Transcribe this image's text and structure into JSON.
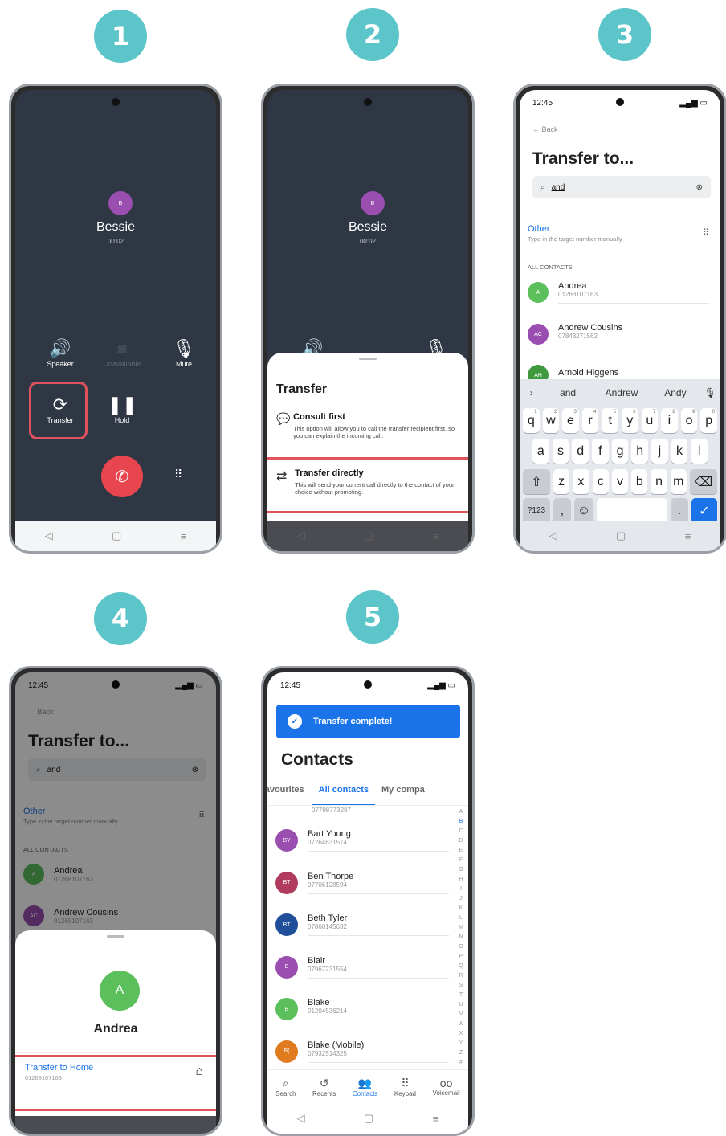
{
  "steps": [
    "1",
    "2",
    "3",
    "4",
    "5"
  ],
  "call": {
    "contact_name": "Bessie",
    "contact_initial": "B",
    "duration": "00:02",
    "speaker_label": "Speaker",
    "unavailable_label": "Unavailable",
    "mute_label": "Mute",
    "transfer_label": "Transfer",
    "hold_label": "Hold"
  },
  "transfer_sheet": {
    "title": "Transfer",
    "consult_title": "Consult first",
    "consult_desc": "This option will allow you to call the transfer recipient first, so you can explain the incoming call.",
    "direct_title": "Transfer directly",
    "direct_desc": "This will send your current call directly to the contact of your choice without prompting."
  },
  "transfer_to": {
    "time": "12:45",
    "back_label": "Back",
    "title": "Transfer to...",
    "search_value": "and",
    "other_label": "Other",
    "other_desc": "Type in the target number manually",
    "section_label": "ALL CONTACTS",
    "contacts": [
      {
        "name": "Andrea",
        "number": "01268107163",
        "initials": "A",
        "color": "#5bbf5b"
      },
      {
        "name": "Andrew Cousins",
        "number": "07843271562",
        "initials": "AC",
        "color": "#9a4fb0"
      },
      {
        "name": "Arnold Higgens",
        "number": "",
        "initials": "AH",
        "color": "#3f9a3f"
      }
    ]
  },
  "keyboard": {
    "suggestions": [
      "and",
      "Andrew",
      "Andy"
    ],
    "row1": [
      "q",
      "w",
      "e",
      "r",
      "t",
      "y",
      "u",
      "i",
      "o",
      "p"
    ],
    "row1_hints": [
      "1",
      "2",
      "3",
      "4",
      "5",
      "6",
      "7",
      "8",
      "9",
      "0"
    ],
    "row2": [
      "a",
      "s",
      "d",
      "f",
      "g",
      "h",
      "j",
      "k",
      "l"
    ],
    "row3": [
      "z",
      "x",
      "c",
      "v",
      "b",
      "n",
      "m"
    ],
    "sym_label": "?123",
    "comma": ",",
    "period": "."
  },
  "step4": {
    "contact_name": "Andrea",
    "contact_number_small": "01268107163",
    "contact_initial": "A",
    "andrew_number": "01268107163",
    "transfer_home_label": "Transfer to Home",
    "transfer_home_number": "01268107163"
  },
  "contacts_screen": {
    "banner": "Transfer complete!",
    "title": "Contacts",
    "tabs": [
      "Favourites",
      "All contacts",
      "My compa"
    ],
    "first_number": "07798773287",
    "list": [
      {
        "name": "Bart Young",
        "number": "07264631574",
        "initials": "BY",
        "color": "#9a4fb0"
      },
      {
        "name": "Ben Thorpe",
        "number": "07706128594",
        "initials": "BT",
        "color": "#b03b5e"
      },
      {
        "name": "Beth Tyler",
        "number": "07860145632",
        "initials": "BT",
        "color": "#1f4f9a"
      },
      {
        "name": "Blair",
        "number": "07967231554",
        "initials": "B",
        "color": "#9a4fb0"
      },
      {
        "name": "Blake",
        "number": "01204536214",
        "initials": "B",
        "color": "#5bbf5b"
      },
      {
        "name": "Blake (Mobile)",
        "number": "07932514325",
        "initials": "B(",
        "color": "#e07b20"
      }
    ],
    "alphabet": [
      "A",
      "B",
      "C",
      "D",
      "E",
      "F",
      "G",
      "H",
      "I",
      "J",
      "K",
      "L",
      "M",
      "N",
      "O",
      "P",
      "Q",
      "R",
      "S",
      "T",
      "U",
      "V",
      "W",
      "X",
      "Y",
      "Z",
      "#"
    ],
    "bottom_nav": [
      "Search",
      "Recents",
      "Contacts",
      "Keypad",
      "Voicemail"
    ]
  },
  "colors": {
    "accent": "#1a73e8",
    "highlight": "#e0535c",
    "badge": "#5cc5c9",
    "end_call": "#e8464f"
  }
}
